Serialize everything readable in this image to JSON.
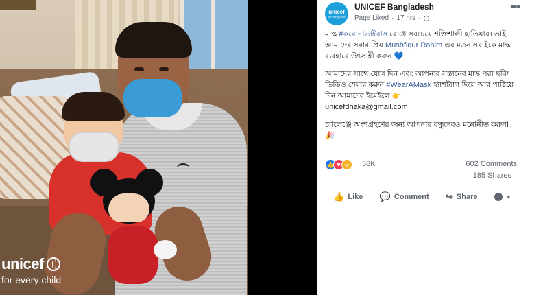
{
  "photo": {
    "brand_word": "unicef",
    "tagline": "for every child"
  },
  "post": {
    "avatar_text": "unicef",
    "avatar_sub": "for every child",
    "page_name": "UNICEF Bangladesh",
    "status": "Page Liked",
    "time": "17 hrs",
    "more_label": "•••",
    "paragraph1_a": "মাস্ক ",
    "hashtag1": "#করোনাভাইরাস",
    "paragraph1_b": " রোধে সবচেয়ে শক্তিশালী হাতিয়ার। তাই আমাদের সবার প্রিয় ",
    "mention": "Mushfiqur Rahim",
    "paragraph1_c": " এর মতন সবাইকে মাস্ক ব্যবহারে উৎসাহী করুন ",
    "paragraph1_emoji": "💙",
    "paragraph2_a": "আমাদের সাথে যোগ দিন এবং আপনার সন্তানের মাস্ক পরা ছবি/ভিডিও শেয়ার করুন ",
    "hashtag2": "#WearAMask",
    "paragraph2_b": " হ্যাশট্যাগ দিয়ে আর পাঠিয়ে দিন আমাদের ইমেইলে ",
    "paragraph2_emoji": "👉",
    "email": "unicefdhaka@gmail.com",
    "paragraph3": "চ্যালেঞ্জে অংশগ্রহণের জন্য আপনার বন্ধুদেরও মনোনীত করুন! ",
    "paragraph3_emoji": "🎉",
    "reactions_count": "58K",
    "comments_count": "602 Comments",
    "shares_count": "185 Shares",
    "actions": {
      "like": "Like",
      "comment": "Comment",
      "share": "Share"
    }
  },
  "icons": {
    "like": "thumbs-up-icon",
    "comment": "speech-bubble-icon",
    "share": "share-arrow-icon",
    "audience": "audience-icon"
  },
  "colors": {
    "link": "#385898",
    "avatar_bg": "#1ca0dc",
    "like_react": "#1877f2",
    "love_react": "#f33e58"
  }
}
